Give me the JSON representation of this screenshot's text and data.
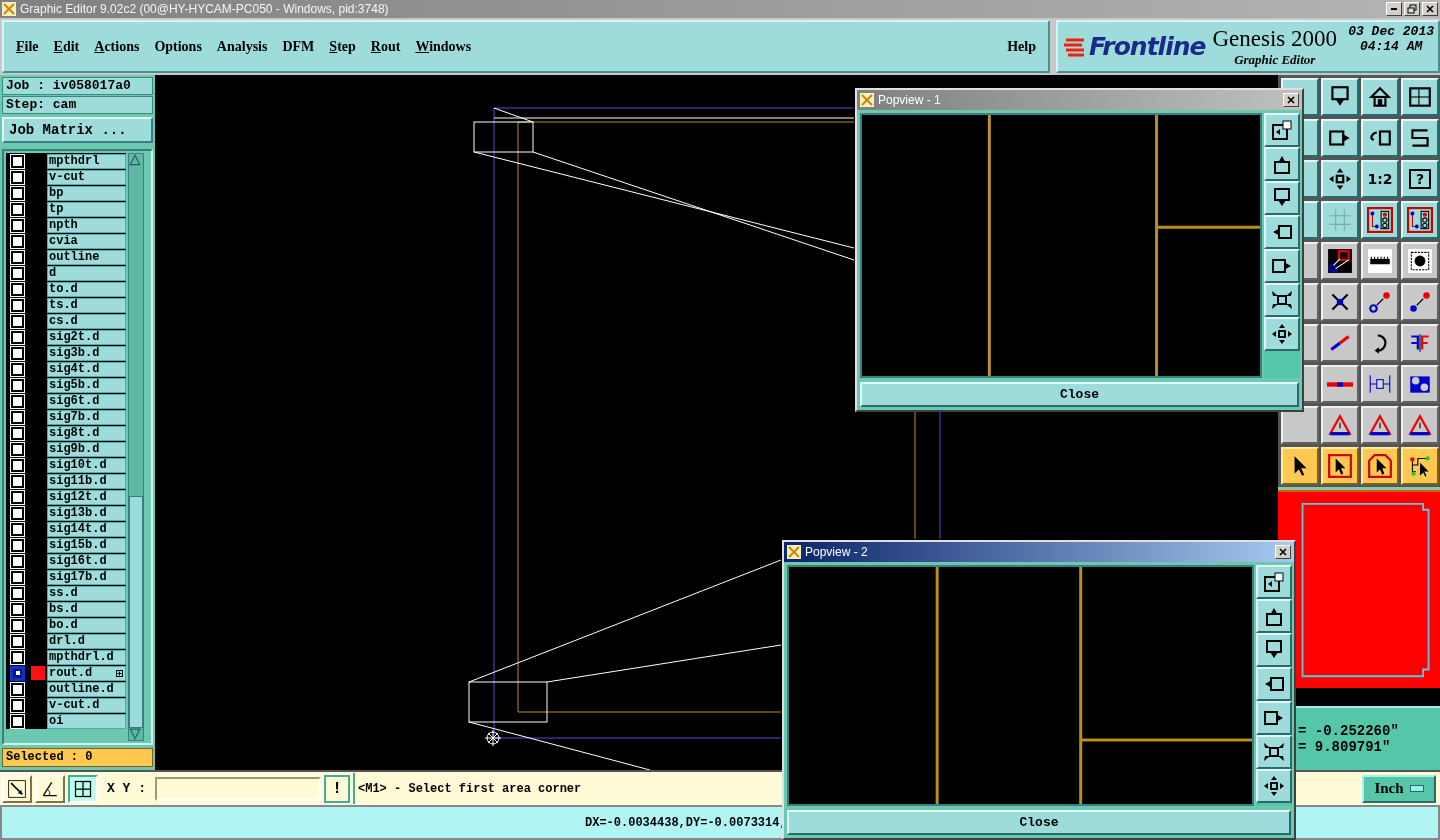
{
  "window": {
    "title": "Graphic Editor 9.02c2 (00@HY-HYCAM-PC050 - Windows, pid:3748)"
  },
  "menu": [
    {
      "label": "File",
      "mnemonic": true
    },
    {
      "label": "Edit",
      "mnemonic": true
    },
    {
      "label": "Actions",
      "mnemonic": true
    },
    {
      "label": "Options",
      "mnemonic": false
    },
    {
      "label": "Analysis",
      "mnemonic": false
    },
    {
      "label": "DFM",
      "mnemonic": false
    },
    {
      "label": "Step",
      "mnemonic": true
    },
    {
      "label": "Rout",
      "mnemonic": true
    },
    {
      "label": "Windows",
      "mnemonic": true
    }
  ],
  "help": "Help",
  "brand": {
    "logo": "Frontline",
    "product": "Genesis 2000",
    "subtitle": "Graphic Editor",
    "date": "03 Dec 2013",
    "time": "04:14 AM"
  },
  "job": "Job : iv058017a0",
  "step": "Step: cam",
  "job_matrix": "Job Matrix ...",
  "layers": [
    {
      "name": "mpthdrl",
      "selected": false,
      "displayed": false
    },
    {
      "name": "v-cut",
      "selected": false,
      "displayed": false
    },
    {
      "name": "bp",
      "selected": false,
      "displayed": false
    },
    {
      "name": "tp",
      "selected": false,
      "displayed": false
    },
    {
      "name": "npth",
      "selected": false,
      "displayed": false
    },
    {
      "name": "cvia",
      "selected": false,
      "displayed": false
    },
    {
      "name": "outline",
      "selected": false,
      "displayed": false
    },
    {
      "name": "d",
      "selected": false,
      "displayed": false
    },
    {
      "name": "to.d",
      "selected": false,
      "displayed": false
    },
    {
      "name": "ts.d",
      "selected": false,
      "displayed": false
    },
    {
      "name": "cs.d",
      "selected": false,
      "displayed": false
    },
    {
      "name": "sig2t.d",
      "selected": false,
      "displayed": false
    },
    {
      "name": "sig3b.d",
      "selected": false,
      "displayed": false
    },
    {
      "name": "sig4t.d",
      "selected": false,
      "displayed": false
    },
    {
      "name": "sig5b.d",
      "selected": false,
      "displayed": false
    },
    {
      "name": "sig6t.d",
      "selected": false,
      "displayed": false
    },
    {
      "name": "sig7b.d",
      "selected": false,
      "displayed": false
    },
    {
      "name": "sig8t.d",
      "selected": false,
      "displayed": false
    },
    {
      "name": "sig9b.d",
      "selected": false,
      "displayed": false
    },
    {
      "name": "sig10t.d",
      "selected": false,
      "displayed": false
    },
    {
      "name": "sig11b.d",
      "selected": false,
      "displayed": false
    },
    {
      "name": "sig12t.d",
      "selected": false,
      "displayed": false
    },
    {
      "name": "sig13b.d",
      "selected": false,
      "displayed": false
    },
    {
      "name": "sig14t.d",
      "selected": false,
      "displayed": false
    },
    {
      "name": "sig15b.d",
      "selected": false,
      "displayed": false
    },
    {
      "name": "sig16t.d",
      "selected": false,
      "displayed": false
    },
    {
      "name": "sig17b.d",
      "selected": false,
      "displayed": false
    },
    {
      "name": "ss.d",
      "selected": false,
      "displayed": false
    },
    {
      "name": "bs.d",
      "selected": false,
      "displayed": false
    },
    {
      "name": "bo.d",
      "selected": false,
      "displayed": false
    },
    {
      "name": "drl.d",
      "selected": false,
      "displayed": false
    },
    {
      "name": "mpthdrl.d",
      "selected": false,
      "displayed": false
    },
    {
      "name": "rout.d",
      "selected": true,
      "displayed": true
    },
    {
      "name": "outline.d",
      "selected": false,
      "displayed": false
    },
    {
      "name": "v-cut.d",
      "selected": false,
      "displayed": false
    },
    {
      "name": "oi",
      "selected": false,
      "displayed": false
    }
  ],
  "selected_count": "Selected : 0",
  "toolbar": {
    "ratio_label": "1:2",
    "help_label": "?"
  },
  "xy_label": "X Y :",
  "exclaim": "!",
  "prompt": "<M1> - Select first area corner",
  "coords": [
    "= -0.252260\"",
    "= 9.809791\""
  ],
  "units": "Inch",
  "status": "DX=-0.0034438,DY=-0.0073314,",
  "popviews": [
    {
      "title": "Popview - 1",
      "close": "Close",
      "active": false
    },
    {
      "title": "Popview - 2",
      "close": "Close",
      "active": true
    }
  ]
}
